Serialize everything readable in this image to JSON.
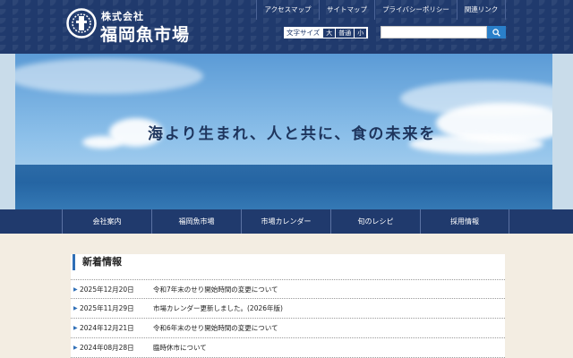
{
  "header": {
    "company_small": "株式会社",
    "company_big": "福岡魚市場",
    "topnav": [
      "アクセスマップ",
      "サイトマップ",
      "プライバシーポリシー",
      "関連リンク"
    ],
    "fontsize": {
      "label": "文字サイズ",
      "large": "大",
      "normal": "普通",
      "small": "小"
    },
    "search": {
      "placeholder": "",
      "icon": "search-icon"
    },
    "colors": {
      "navy": "#203a6d",
      "accent_blue": "#2a7fc9"
    }
  },
  "hero": {
    "tagline": "海より生まれ、人と共に、食の未来を"
  },
  "mainnav": [
    "会社案内",
    "福岡魚市場",
    "市場カレンダー",
    "旬のレシピ",
    "採用情報"
  ],
  "news": {
    "title": "新着情報",
    "items": [
      {
        "date": "2025年12月20日",
        "text": "令和7年末のせり開始時間の変更について"
      },
      {
        "date": "2025年11月29日",
        "text": "市場カレンダー更新しました。(2026年版)"
      },
      {
        "date": "2024年12月21日",
        "text": "令和6年末のせり開始時間の変更について"
      },
      {
        "date": "2024年08月28日",
        "text": "臨時休市について"
      }
    ]
  }
}
